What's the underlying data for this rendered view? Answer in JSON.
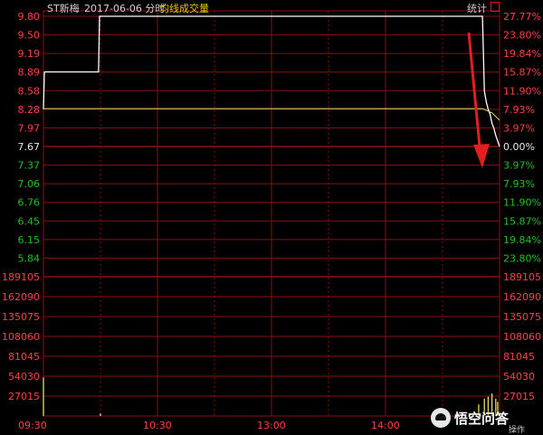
{
  "header": {
    "stock_name": "ST新梅",
    "date_mode": "2017-06-06 分时",
    "avg_line_label": "均线",
    "volume_label": "成交量",
    "stats_button": "统计"
  },
  "colors": {
    "background": "#000000",
    "grid": "#8b1010",
    "up": "#ff4040",
    "down": "#20c020",
    "neutral": "#e6e6e6",
    "price_line": "#ffffff",
    "arrow": "#e02020"
  },
  "chart_data": {
    "type": "line",
    "reference_price": 7.67,
    "price_ticks": [
      9.8,
      9.5,
      9.19,
      8.89,
      8.58,
      8.28,
      7.97,
      7.67,
      7.37,
      7.06,
      6.76,
      6.45,
      6.15,
      5.84
    ],
    "price_tick_labels": [
      "9.80",
      "9.50",
      "9.19",
      "8.89",
      "8.58",
      "8.28",
      "7.97",
      "7.67",
      "7.37",
      "7.06",
      "6.76",
      "6.45",
      "6.15",
      "5.84"
    ],
    "pct_tick_labels": [
      "27.77%",
      "23.80%",
      "19.84%",
      "15.87%",
      "11.90%",
      "7.93%",
      "3.97%",
      "0.00%",
      "3.97%",
      "7.93%",
      "11.90%",
      "15.87%",
      "19.84%",
      "23.80%"
    ],
    "volume_tick_labels": [
      "189105",
      "162090",
      "135075",
      "108060",
      "81045",
      "54030",
      "27015"
    ],
    "volume_ticks": [
      189105,
      162090,
      135075,
      108060,
      81045,
      54030,
      27015
    ],
    "time_labels": [
      "09:30",
      "10:30",
      "13:00",
      "14:00"
    ],
    "ylim": [
      5.84,
      9.8
    ],
    "price_series": {
      "x_minutes": [
        0,
        0.5,
        1,
        29,
        29.5,
        30,
        231,
        232,
        233,
        234,
        235,
        236,
        237,
        238,
        240
      ],
      "y": [
        8.28,
        8.89,
        8.89,
        8.89,
        9.8,
        9.8,
        9.8,
        8.58,
        8.4,
        8.28,
        8.2,
        8.05,
        7.97,
        7.85,
        7.67
      ]
    },
    "avg_series": {
      "x_minutes": [
        0,
        60,
        120,
        231,
        236,
        240
      ],
      "y": [
        8.29,
        8.29,
        8.29,
        8.29,
        8.22,
        8.1
      ]
    },
    "volume_bars": {
      "x_minutes": [
        0,
        30,
        229,
        232,
        234,
        236,
        238,
        240
      ],
      "values": [
        60000,
        4000,
        18000,
        27015,
        30000,
        35000,
        27000,
        22000
      ]
    },
    "annotation": "downward red arrow near close"
  },
  "watermark": {
    "text": "悟空问答"
  },
  "footer": {
    "op_label": "操作"
  }
}
